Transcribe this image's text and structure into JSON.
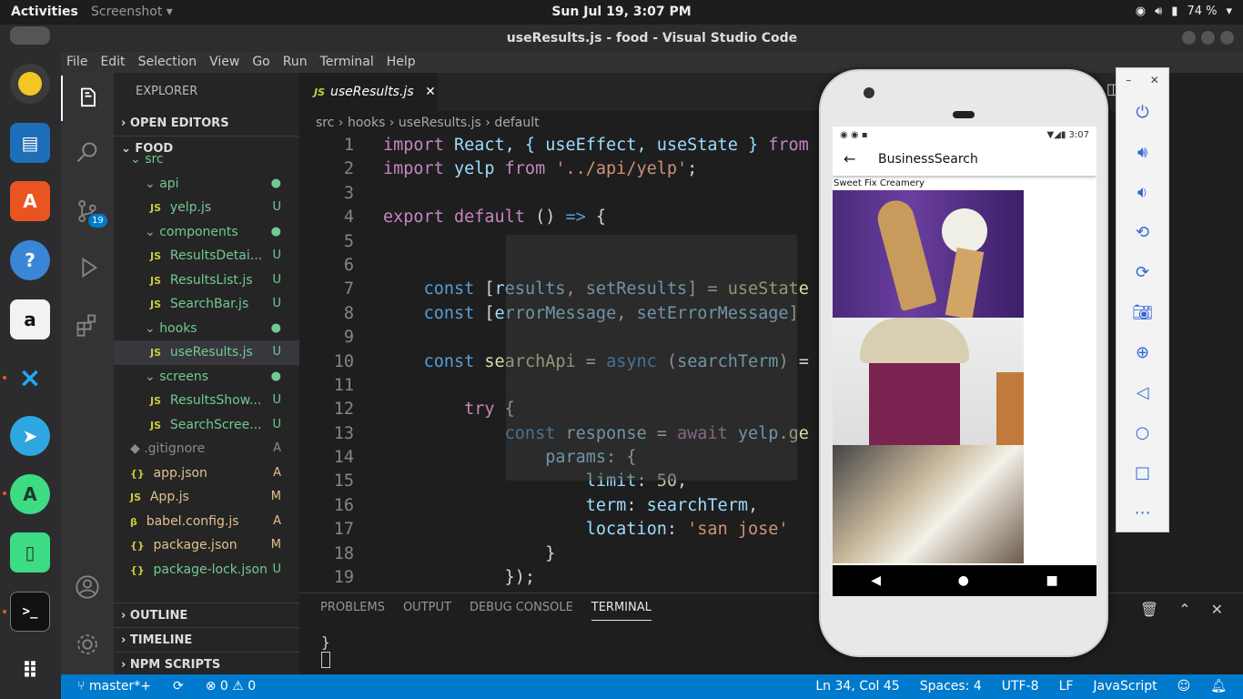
{
  "topbar": {
    "activities": "Activities",
    "app_menu": "Screenshot ▾",
    "clock": "Sun Jul 19,  3:07 PM",
    "battery": "74 %"
  },
  "window": {
    "title": "useResults.js - food - Visual Studio Code"
  },
  "menu": [
    "File",
    "Edit",
    "Selection",
    "View",
    "Go",
    "Run",
    "Terminal",
    "Help"
  ],
  "activity": {
    "scm_badge": "19"
  },
  "explorer": {
    "title": "EXPLORER",
    "open_editors": "OPEN EDITORS",
    "folder": "FOOD",
    "items": [
      {
        "name": "src",
        "indent": 1,
        "type": "folder",
        "status": "",
        "color": "green"
      },
      {
        "name": "api",
        "indent": 2,
        "type": "folder",
        "status": "●",
        "color": "green"
      },
      {
        "name": "yelp.js",
        "indent": 3,
        "type": "file",
        "status": "U",
        "color": "green"
      },
      {
        "name": "components",
        "indent": 2,
        "type": "folder",
        "status": "●",
        "color": "green"
      },
      {
        "name": "ResultsDetai...",
        "indent": 3,
        "type": "file",
        "status": "U",
        "color": "green"
      },
      {
        "name": "ResultsList.js",
        "indent": 3,
        "type": "file",
        "status": "U",
        "color": "green"
      },
      {
        "name": "SearchBar.js",
        "indent": 3,
        "type": "file",
        "status": "U",
        "color": "green"
      },
      {
        "name": "hooks",
        "indent": 2,
        "type": "folder",
        "status": "●",
        "color": "green"
      },
      {
        "name": "useResults.js",
        "indent": 3,
        "type": "file",
        "status": "U",
        "color": "green",
        "selected": true
      },
      {
        "name": "screens",
        "indent": 2,
        "type": "folder",
        "status": "●",
        "color": "green"
      },
      {
        "name": "ResultsShow...",
        "indent": 3,
        "type": "file",
        "status": "U",
        "color": "green"
      },
      {
        "name": "SearchScree...",
        "indent": 3,
        "type": "file",
        "status": "U",
        "color": "green"
      },
      {
        "name": ".gitignore",
        "indent": 1,
        "type": "file",
        "status": "A",
        "color": "grey"
      },
      {
        "name": "app.json",
        "indent": 1,
        "type": "json",
        "status": "A",
        "color": "yellow"
      },
      {
        "name": "App.js",
        "indent": 1,
        "type": "file",
        "status": "M",
        "color": "yellow"
      },
      {
        "name": "babel.config.js",
        "indent": 1,
        "type": "babel",
        "status": "A",
        "color": "yellow"
      },
      {
        "name": "package.json",
        "indent": 1,
        "type": "json",
        "status": "M",
        "color": "yellow"
      },
      {
        "name": "package-lock.json",
        "indent": 1,
        "type": "json",
        "status": "U",
        "color": "green"
      }
    ],
    "outline": "OUTLINE",
    "timeline": "TIMELINE",
    "npm": "NPM SCRIPTS"
  },
  "editor": {
    "tab": "useResults.js",
    "breadcrumb": [
      "src",
      "hooks",
      "useResults.js",
      "default"
    ],
    "lines": [
      {
        "n": "1",
        "html": "<span class='ctl'>import</span> React, { useEffect, useState } <span class='ctl'>from</span>"
      },
      {
        "n": "2",
        "html": "<span class='ctl'>import</span> yelp <span class='ctl'>from</span> <span class='str'>'../api/yelp'</span><span class='pl'>;</span>"
      },
      {
        "n": "3",
        "html": ""
      },
      {
        "n": "4",
        "html": "<span class='ctl'>export</span> <span class='ctl'>default</span> <span class='pl'>() </span><span class='kw'>=&gt;</span><span class='pl'> {</span>"
      },
      {
        "n": "5",
        "html": ""
      },
      {
        "n": "6",
        "html": ""
      },
      {
        "n": "7",
        "html": "    <span class='kw'>const</span> <span class='pl'>[</span>results<span class='pl'>,</span> setResults<span class='pl'>] =</span> <span class='fn'>useState</span>"
      },
      {
        "n": "8",
        "html": "    <span class='kw'>const</span> <span class='pl'>[</span>errorMessage<span class='pl'>,</span> setErrorMessage<span class='pl'>]</span>"
      },
      {
        "n": "9",
        "html": ""
      },
      {
        "n": "10",
        "html": "    <span class='kw'>const</span> <span class='fn'>searchApi</span> <span class='pl'>=</span> <span class='kw'>async</span> <span class='pl'>(</span>searchTerm<span class='pl'>) =</span>"
      },
      {
        "n": "11",
        "html": ""
      },
      {
        "n": "12",
        "html": "        <span class='ctl'>try</span> <span class='pl'>{</span>"
      },
      {
        "n": "13",
        "html": "            <span class='kw'>const</span> response <span class='pl'>=</span> <span class='ctl'>await</span> yelp<span class='pl'>.</span><span class='fn'>ge</span>"
      },
      {
        "n": "14",
        "html": "                params<span class='pl'>: {</span>"
      },
      {
        "n": "15",
        "html": "                    limit<span class='pl'>:</span> <span class='num'>50</span><span class='pl'>,</span>"
      },
      {
        "n": "16",
        "html": "                    term<span class='pl'>:</span> searchTerm<span class='pl'>,</span>"
      },
      {
        "n": "17",
        "html": "                    location<span class='pl'>:</span> <span class='str'>'san jose'</span>"
      },
      {
        "n": "18",
        "html": "                <span class='pl'>}</span>"
      },
      {
        "n": "19",
        "html": "            <span class='pl'>});</span>"
      }
    ]
  },
  "panel": {
    "tabs": [
      "PROBLEMS",
      "OUTPUT",
      "DEBUG CONSOLE",
      "TERMINAL"
    ],
    "active": "TERMINAL",
    "terminal": "}"
  },
  "status": {
    "branch": "master*+",
    "errors": "0",
    "warnings": "0",
    "position": "Ln 34, Col 45",
    "spaces": "Spaces: 4",
    "encoding": "UTF-8",
    "eol": "LF",
    "language": "JavaScript"
  },
  "phone": {
    "time": "3:07",
    "title": "BusinessSearch",
    "business_name": "Sweet Fix Creamery"
  },
  "colors": {
    "accent": "#007acc",
    "ubuntu_orange": "#e95420"
  }
}
